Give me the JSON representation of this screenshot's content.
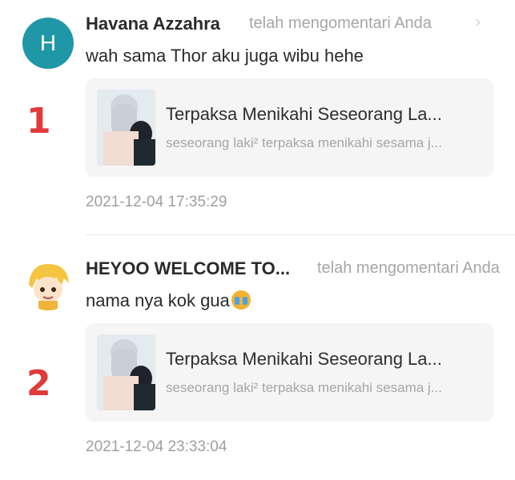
{
  "comments": [
    {
      "avatar_letter": "H",
      "name": "Havana Azzahra",
      "action": "telah mengomentari Anda",
      "chevron": "›",
      "text": "wah sama Thor aku juga wibu hehe",
      "card": {
        "title": "Terpaksa Menikahi Seseorang La...",
        "description": "seseorang laki² terpaksa menikahi sesama j..."
      },
      "timestamp": "2021-12-04 17:35:29",
      "annotation_number": "1"
    },
    {
      "name": "HEYOO WELCOME TO...",
      "action": "telah mengomentari Anda",
      "text": "nama nya kok gua",
      "emoji": "loudly-crying-face",
      "card": {
        "title": "Terpaksa Menikahi Seseorang La...",
        "description": "seseorang laki² terpaksa menikahi sesama j..."
      },
      "timestamp": "2021-12-04 23:33:04",
      "annotation_number": "2"
    }
  ],
  "colors": {
    "avatar_teal": "#1f97a6",
    "annotation_red": "#e03a3a",
    "card_bg": "#f5f5f5",
    "muted_text": "#a6a6a6"
  }
}
